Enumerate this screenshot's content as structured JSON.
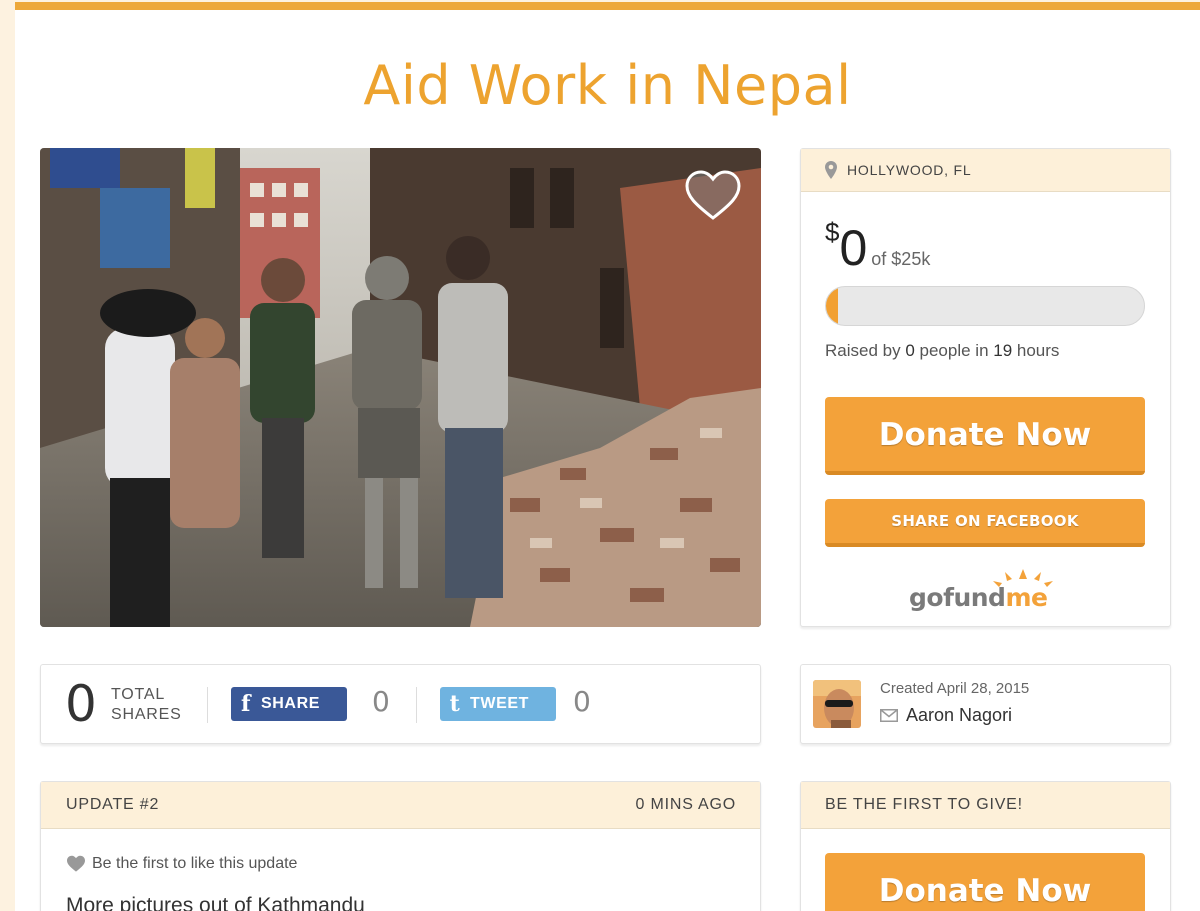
{
  "campaign": {
    "title": "Aid Work in Nepal"
  },
  "location": {
    "label": "HOLLYWOOD, FL"
  },
  "funding": {
    "currency_symbol": "$",
    "raised": "0",
    "goal_text": "of $25k",
    "progress_fraction": 0.0,
    "raised_by_prefix": "Raised by ",
    "people_count": "0",
    "people_suffix": " people in ",
    "hours": "19",
    "hours_suffix": " hours"
  },
  "actions": {
    "donate_label": "Donate Now",
    "share_facebook_label": "SHARE ON FACEBOOK"
  },
  "brand": {
    "logo_part1": "gofund",
    "logo_part2": "me",
    "color_gray": "#7a7a7a",
    "color_orange": "#f3a23a"
  },
  "shares": {
    "total": "0",
    "total_label_1": "TOTAL",
    "total_label_2": "SHARES",
    "facebook_label": "SHARE",
    "facebook_count": "0",
    "twitter_label": "TWEET",
    "twitter_count": "0"
  },
  "creator": {
    "created_text": "Created April 28, 2015",
    "name": "Aaron Nagori"
  },
  "update": {
    "header": "UPDATE #2",
    "time_ago": "0 MINS AGO",
    "like_text": "Be the first to like this update",
    "body": "More pictures out of Kathmandu"
  },
  "give": {
    "header": "BE THE FIRST TO GIVE!",
    "donate_label": "Donate Now"
  },
  "colors": {
    "accent": "#eda32f",
    "header_bg": "#fdf0d9",
    "facebook": "#3a5897",
    "twitter": "#6fb3e0"
  }
}
